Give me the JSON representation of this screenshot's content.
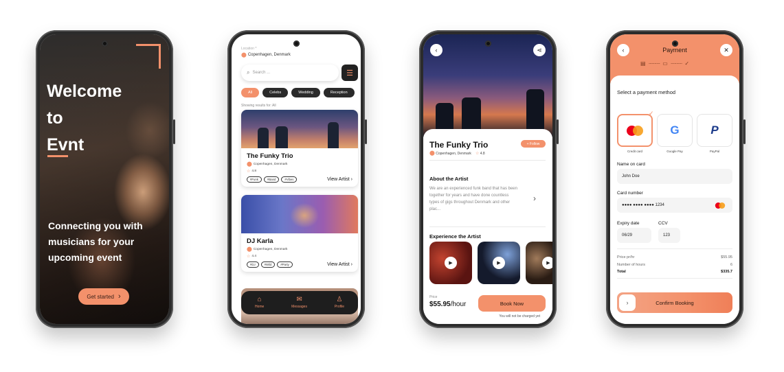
{
  "welcome": {
    "headline_lines": [
      "Welcome",
      "to",
      "Evnt"
    ],
    "tagline": "Connecting you with musicians for your upcoming event",
    "cta_label": "Get started"
  },
  "browse": {
    "location_label": "Location ^",
    "location": "Copenhagen, Denmark",
    "search_placeholder": "Search ...",
    "chips": [
      "All",
      "Celebs",
      "Wedding",
      "Reception"
    ],
    "results_text": "Showing results for: All",
    "cards": [
      {
        "title": "The Funky Trio",
        "location": "Copenhagen, Denmark",
        "rating": "4.8",
        "tags": [
          "#Funk",
          "#Band",
          "#Vibes"
        ],
        "cta": "View Artist"
      },
      {
        "title": "DJ Karla",
        "location": "Copenhagen, Denmark",
        "rating": "4.4",
        "tags": [
          "#DJ",
          "#Wild",
          "#Party"
        ],
        "cta": "View Artist"
      }
    ],
    "nav": [
      {
        "label": "Home",
        "icon": "home-icon"
      },
      {
        "label": "Messages",
        "icon": "mail-icon"
      },
      {
        "label": "Profile",
        "icon": "user-icon"
      }
    ]
  },
  "artist": {
    "name": "The Funky Trio",
    "follow_label": "+ Follow",
    "location": "Copenhagen, Denmark",
    "rating": "4.8",
    "about_heading": "About the Artist",
    "about_text": "We are an experienced funk band that has been together for years and have done countless types of gigs throughout Denmark and other plac...",
    "experience_heading": "Experience the Artist",
    "price_label": "Price",
    "price": "$55.95",
    "price_unit": "/hour",
    "book_label": "Book Now",
    "charge_note": "You will not be charged yet"
  },
  "payment": {
    "title": "Payment",
    "select_label": "Select a payment method",
    "methods": [
      "Credit card",
      "Google Pay",
      "PayPal"
    ],
    "name_label": "Name on card",
    "name_value": "John Doe",
    "card_label": "Card number",
    "card_value": "●●●● ●●●● ●●●● 1234",
    "expiry_label": "Expiry date",
    "expiry_value": "06/29",
    "ccv_label": "CCV",
    "ccv_value": "123",
    "summary": [
      {
        "label": "Price pr/hr",
        "value": "$55.95"
      },
      {
        "label": "Number of hours",
        "value": "6"
      },
      {
        "label": "Total",
        "value": "$335.7"
      }
    ],
    "confirm_label": "Confirm Booking"
  },
  "colors": {
    "accent": "#f3916b",
    "dark": "#1e1e1e"
  }
}
